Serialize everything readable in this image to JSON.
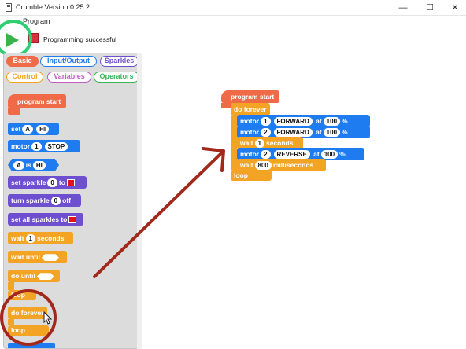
{
  "window": {
    "title": "Crumble Version 0.25.2",
    "minimize_icon": "minimize-icon",
    "maximize_icon": "maximize-icon",
    "close_icon": "close-icon"
  },
  "menu": {
    "program": "Program"
  },
  "toolbar": {
    "status": "Programming successful"
  },
  "tabs": {
    "basic": "Basic",
    "io": "Input/Output",
    "sparkles": "Sparkles",
    "control": "Control",
    "variables": "Variables",
    "operators": "Operators"
  },
  "palette": {
    "program_start": "program start",
    "set": "set",
    "set_a": "A",
    "set_hi": "HI",
    "motor": "motor",
    "motor_num": "1",
    "motor_stop": "STOP",
    "cond_a": "A",
    "cond_is": "is",
    "cond_hi": "HI",
    "set_sparkle": "set sparkle",
    "set_sparkle_num": "0",
    "set_sparkle_to": "to",
    "turn_sparkle": "turn sparkle",
    "turn_sparkle_num": "0",
    "turn_sparkle_off": "off",
    "set_all": "set all sparkles to",
    "wait": "wait",
    "wait_num": "1",
    "wait_unit": "seconds",
    "wait_until": "wait until",
    "do_until": "do until",
    "do_until_loop": "loop",
    "do_forever": "do forever",
    "do_forever_loop": "loop"
  },
  "program": {
    "start": "program start",
    "do_forever": "do forever",
    "loop": "loop",
    "motor": "motor",
    "at": "at",
    "pct": "%",
    "m1_num": "1",
    "m1_dir": "FORWARD",
    "m1_speed": "100",
    "m2_num": "2",
    "m2_dir": "FORWARD",
    "m2_speed": "100",
    "wait": "wait",
    "wait1_num": "1",
    "wait1_unit": "seconds",
    "m3_num": "2",
    "m3_dir": "REVERSE",
    "m3_speed": "100",
    "wait2_num": "800",
    "wait2_unit": "milliseconds"
  },
  "colors": {
    "blue": "#1e7cf0",
    "orange": "#f3a424",
    "salmon": "#f06a48",
    "purple": "#6d4fcf",
    "green_highlight": "#2fce72",
    "annotation_red": "#a3281c"
  }
}
